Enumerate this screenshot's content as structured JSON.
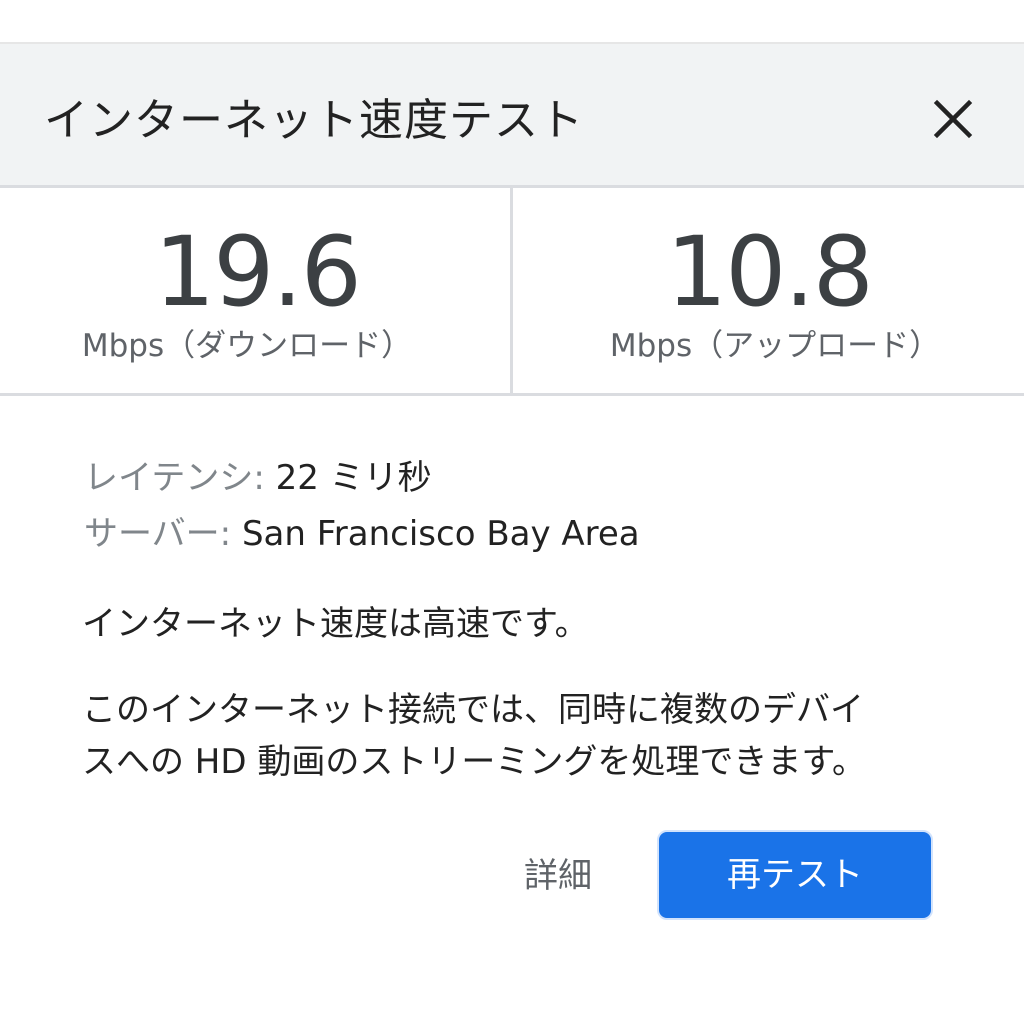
{
  "header": {
    "title": "インターネット速度テスト",
    "close_icon": "close-icon"
  },
  "results": {
    "download": {
      "value": "19.6",
      "unit": "Mbps（ダウンロード）"
    },
    "upload": {
      "value": "10.8",
      "unit": "Mbps（アップロード）"
    }
  },
  "info": {
    "latency_label": "レイテンシ:",
    "latency_value": "22 ミリ秒",
    "server_label": "サーバー:",
    "server_value": "San Francisco Bay Area"
  },
  "summary": "インターネット速度は高速です。",
  "description": {
    "line1": "このインターネット接続では、同時に複数のデバイ",
    "line2": "スへの HD 動画のストリーミングを処理できます。"
  },
  "actions": {
    "details_label": "詳細",
    "retest_label": "再テスト"
  },
  "colors": {
    "accent": "#1a73e8",
    "header_bg": "#f1f3f4",
    "divider": "#dadce0",
    "text_primary": "#222222",
    "text_secondary": "#5f6368"
  }
}
